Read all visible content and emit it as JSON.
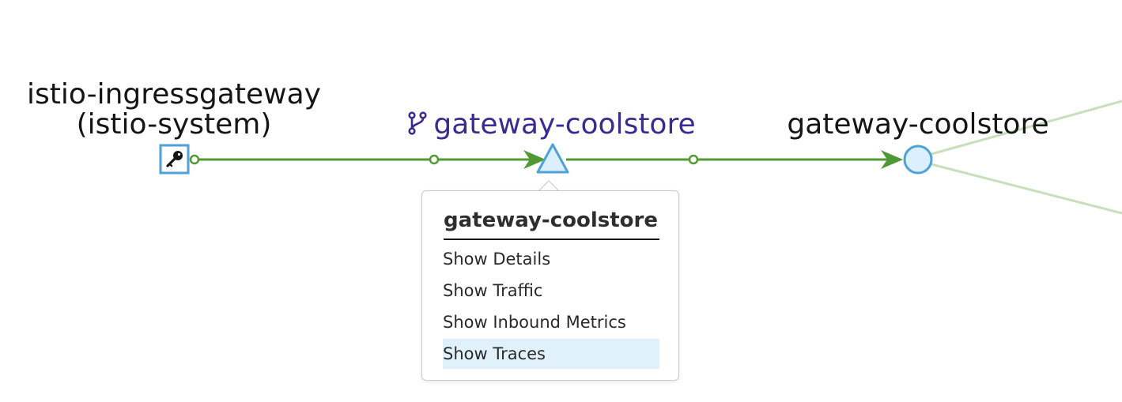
{
  "graph": {
    "nodes": {
      "ingress": {
        "label_line1": "istio-ingressgateway",
        "label_line2": "(istio-system)",
        "icon": "key-icon"
      },
      "service": {
        "label": "gateway-coolstore",
        "icon": "code-branch-icon"
      },
      "workload": {
        "label": "gateway-coolstore"
      }
    },
    "colors": {
      "edge": "#4f9a35",
      "edge_faded": "#c7dfbd",
      "node_stroke": "#4ea2d6",
      "node_fill": "#dcefff",
      "service_label": "#3b2a92",
      "label": "#151515"
    }
  },
  "context_menu": {
    "title": "gateway-coolstore",
    "items": [
      {
        "label": "Show Details"
      },
      {
        "label": "Show Traffic"
      },
      {
        "label": "Show Inbound Metrics"
      },
      {
        "label": "Show Traces",
        "active": true
      }
    ]
  }
}
